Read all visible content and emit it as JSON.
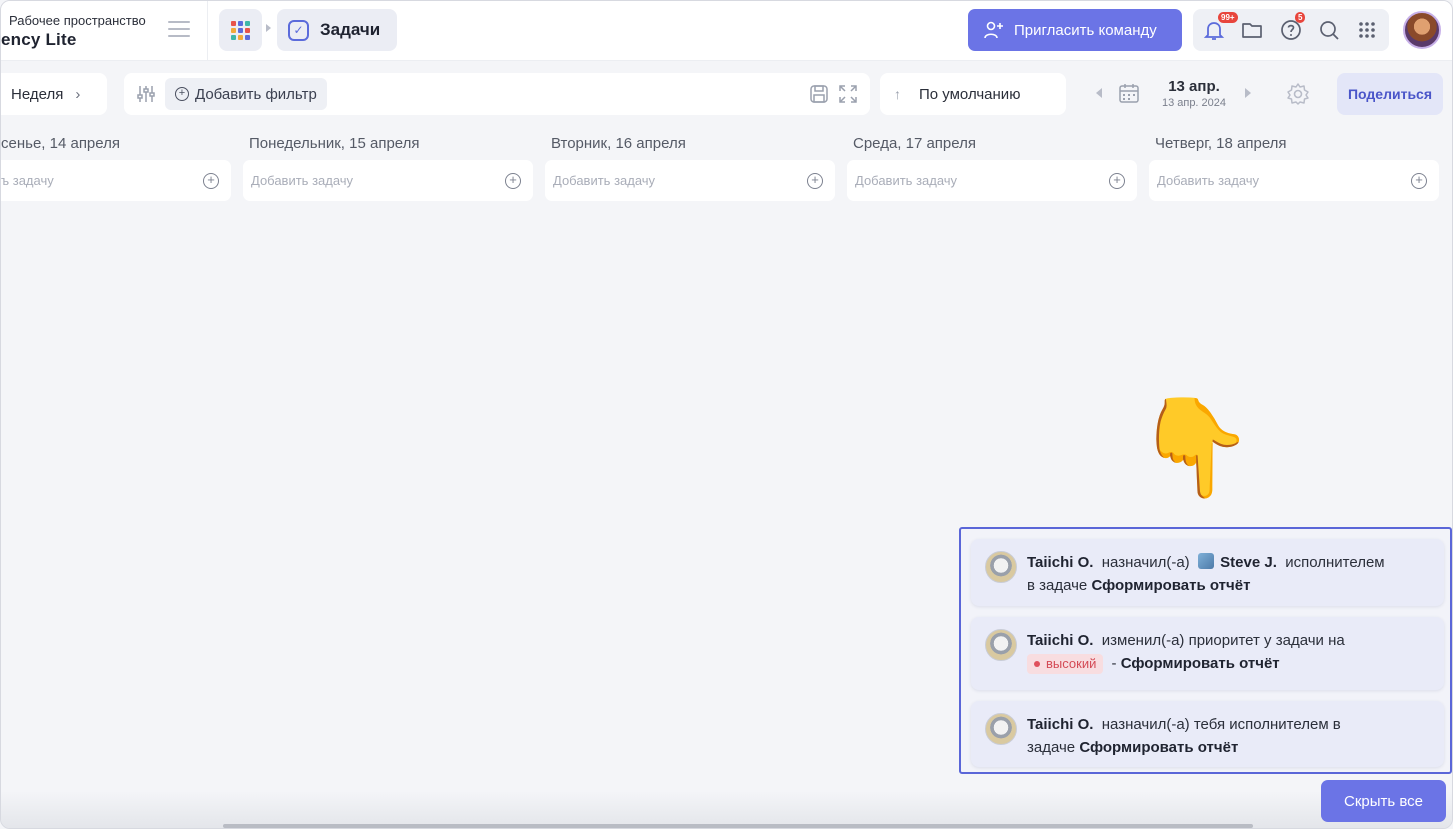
{
  "workspace": {
    "caption": "Рабочее пространство",
    "name": "ency Lite"
  },
  "breadcrumb": {
    "current": "Задачи"
  },
  "header": {
    "invite_label": "Пригласить команду",
    "notifications_badge": "99+",
    "help_badge": "5"
  },
  "toolbar": {
    "view_label": "Неделя",
    "add_filter_label": "Добавить фильтр",
    "sort_label": "По умолчанию",
    "date_main": "13 апр.",
    "date_sub": "13 апр. 2024",
    "share_label": "Поделиться"
  },
  "days": [
    {
      "title": "сенье, 14 апреля",
      "placeholder": "ъ задачу"
    },
    {
      "title": "Понедельник, 15 апреля",
      "placeholder": "Добавить задачу"
    },
    {
      "title": "Вторник, 16 апреля",
      "placeholder": "Добавить задачу"
    },
    {
      "title": "Среда, 17 апреля",
      "placeholder": "Добавить задачу"
    },
    {
      "title": "Четверг, 18 апреля",
      "placeholder": "Добавить задачу"
    }
  ],
  "pointer_emoji": "👇",
  "notifications": [
    {
      "user": "Taiichi O.",
      "action": "назначил(-а)",
      "target_user": "Steve J.",
      "rest": "исполнителем",
      "line2_prefix": "в задаче",
      "task": "Сформировать отчёт"
    },
    {
      "user": "Taiichi O.",
      "action": "изменил(-а) приоритет у задачи на",
      "priority": "высокий",
      "dash": "-",
      "task": "Сформировать отчёт"
    },
    {
      "user": "Taiichi O.",
      "action": "назначил(-а) тебя исполнителем в",
      "line2_prefix": "задаче",
      "task": "Сформировать отчёт"
    }
  ],
  "hide_all_label": "Скрыть все",
  "colors": {
    "accent": "#6b74e6",
    "priority_high": "#d44a55",
    "badge": "#e8453c"
  }
}
